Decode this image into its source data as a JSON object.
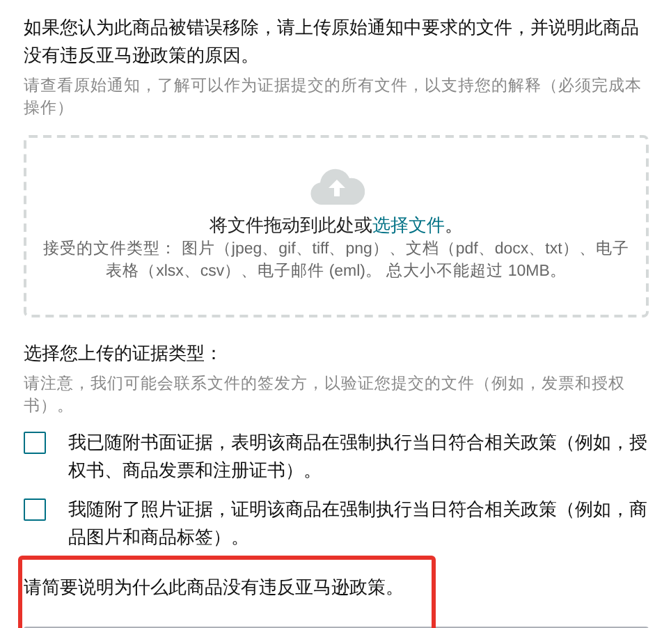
{
  "intro": {
    "title": "如果您认为此商品被错误移除，请上传原始通知中要求的文件，并说明此商品没有违反亚马逊政策的原因。",
    "hint": "请查看原始通知，了解可以作为证据提交的所有文件，以支持您的解释（必须完成本操作）"
  },
  "drop_zone": {
    "prompt": "将文件拖动到此处或",
    "link": "选择文件",
    "prompt_end": "。",
    "accepted": "接受的文件类型： 图片（jpeg、gif、tiff、png）、文档（pdf、docx、txt）、电子表格（xlsx、csv）、电子邮件 (eml)。 总大小不能超过 10MB。"
  },
  "evidence": {
    "title": "选择您上传的证据类型：",
    "hint": "请注意，我们可能会联系文件的签发方，以验证您提交的文件（例如，发票和授权书）。",
    "options": [
      {
        "label": "我已随附书面证据，表明该商品在强制执行当日符合相关政策（例如，授权书、商品发票和注册证书）。",
        "checked": false
      },
      {
        "label": "我随附了照片证据，证明该商品在强制执行当日符合相关政策（例如，商品图片和商品标签）。",
        "checked": false
      }
    ]
  },
  "explanation": {
    "label": "请简要说明为什么此商品没有违反亚马逊政策。"
  },
  "highlight": true
}
